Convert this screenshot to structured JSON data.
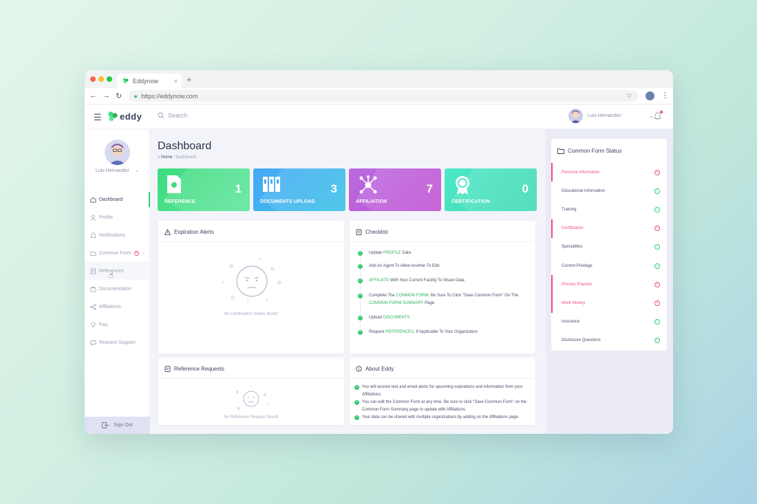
{
  "browser": {
    "tab_title": "Eddynow",
    "url": "https://eddynow.com",
    "tab_close": "×",
    "new_tab": "+"
  },
  "header": {
    "logo_text": "eddy",
    "search_placeholder": "Search",
    "user_name": "Luis Hernandez"
  },
  "sidebar": {
    "user_name": "Luis Hernandez",
    "items": [
      {
        "label": "Dashboard",
        "icon": "home-icon"
      },
      {
        "label": "Profile",
        "icon": "user-icon"
      },
      {
        "label": "Notifications",
        "icon": "bell-icon"
      },
      {
        "label": "Common Form",
        "icon": "folder-icon"
      },
      {
        "label": "References",
        "icon": "document-icon"
      },
      {
        "label": "Documentation",
        "icon": "briefcase-icon"
      },
      {
        "label": "Affiliations",
        "icon": "share-icon"
      },
      {
        "label": "Faq",
        "icon": "bulb-icon"
      },
      {
        "label": "Request Support",
        "icon": "chat-icon"
      }
    ],
    "sign_out": "Sign Out"
  },
  "main": {
    "title": "Dashboard",
    "breadcrumb_home": "Home",
    "breadcrumb_sep": " / ",
    "breadcrumb_current": "Dashboard",
    "tiles": [
      {
        "label": "REFERENCE",
        "count": "1",
        "color": "#3ddc7e"
      },
      {
        "label": "DOCUMENTS UPLOAD",
        "count": "3",
        "color": "#46a8f4"
      },
      {
        "label": "AFFILIATION",
        "count": "7",
        "color": "#b86be0"
      },
      {
        "label": "CERTIFICATION",
        "count": "0",
        "color": "#4de8c8"
      }
    ],
    "expiration": {
      "title": "Expiration Alerts",
      "empty": "No Certification Status found!"
    },
    "checklist": {
      "title": "Checklist",
      "items": [
        {
          "pre": "Update ",
          "hl": "PROFILE",
          "post": " Data"
        },
        {
          "pre": "Add An Agent To Allow Another To Edit.",
          "hl": "",
          "post": ""
        },
        {
          "pre": "",
          "hl": "AFFILIATE",
          "post": " With Your Current Facility To Share Data."
        },
        {
          "pre": "Complete The ",
          "hl": "COMMON FORM",
          "post": ". Be Sure To Click \"Save Common Form\" On The ",
          "hl2": "COMMON FORM SUMMARY",
          "post2": " Page."
        },
        {
          "pre": "Upload ",
          "hl": "DOCUMENTS",
          "post": ""
        },
        {
          "pre": "Request ",
          "hl": "REFERENCES",
          "post": ", If Applicable To Your Organization"
        }
      ]
    },
    "references": {
      "title": "Reference Requests",
      "empty": "No Reference Request found!"
    },
    "about": {
      "title": "About Eddy",
      "items": [
        "You will receive text and email alerts for upcoming expirations and information from your Affiliations.",
        "You can edit the Common Form at any time. Be sure to click \"Save Common Form\" on the Common Form Summary page to update with Affiliations.",
        "Your data can be shared with multiple organizations by adding on the Affiliations page."
      ]
    }
  },
  "status_panel": {
    "title": "Common Form Status",
    "items": [
      {
        "label": "Personal Information",
        "ok": false
      },
      {
        "label": "Educational Information",
        "ok": true
      },
      {
        "label": "Training",
        "ok": true
      },
      {
        "label": "Certification",
        "ok": false
      },
      {
        "label": "Specialities",
        "ok": true
      },
      {
        "label": "Current Privilege",
        "ok": true
      },
      {
        "label": "Primary Practice",
        "ok": false
      },
      {
        "label": "Work History",
        "ok": false
      },
      {
        "label": "Insurance",
        "ok": true
      },
      {
        "label": "Disclosure Questions",
        "ok": true
      }
    ],
    "colors": {
      "ok": "#35c974",
      "bad": "#ef4d78"
    }
  }
}
